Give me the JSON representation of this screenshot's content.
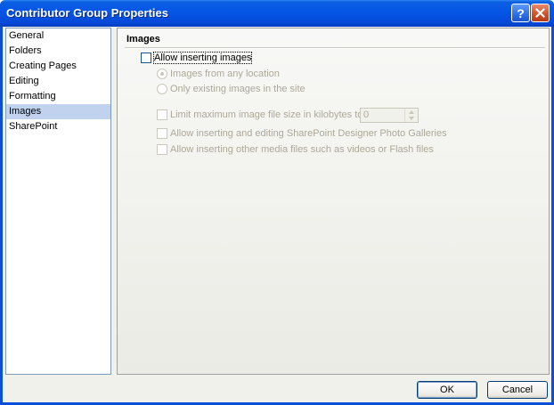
{
  "window": {
    "title": "Contributor Group Properties"
  },
  "titlebar": {
    "help_glyph": "?"
  },
  "nav": {
    "items": [
      {
        "label": "General"
      },
      {
        "label": "Folders"
      },
      {
        "label": "Creating Pages"
      },
      {
        "label": "Editing"
      },
      {
        "label": "Formatting"
      },
      {
        "label": "Images",
        "selected": true
      },
      {
        "label": "SharePoint"
      }
    ]
  },
  "images": {
    "heading": "Images",
    "allow_inserting": {
      "label": "Allow inserting images",
      "checked": false,
      "enabled": true
    },
    "from_any_location": {
      "label": "Images from any location",
      "selected": true,
      "enabled": false
    },
    "only_existing": {
      "label": "Only existing images in the site",
      "selected": false,
      "enabled": false
    },
    "limit_size": {
      "label": "Limit maximum image file size in kilobytes to:",
      "checked": false,
      "enabled": false
    },
    "size_value": "0",
    "photo_galleries": {
      "label": "Allow inserting and editing SharePoint Designer Photo Galleries",
      "checked": false,
      "enabled": false
    },
    "other_media": {
      "label": "Allow inserting other media files such as videos or Flash files",
      "checked": false,
      "enabled": false
    }
  },
  "buttons": {
    "ok": "OK",
    "cancel": "Cancel"
  }
}
